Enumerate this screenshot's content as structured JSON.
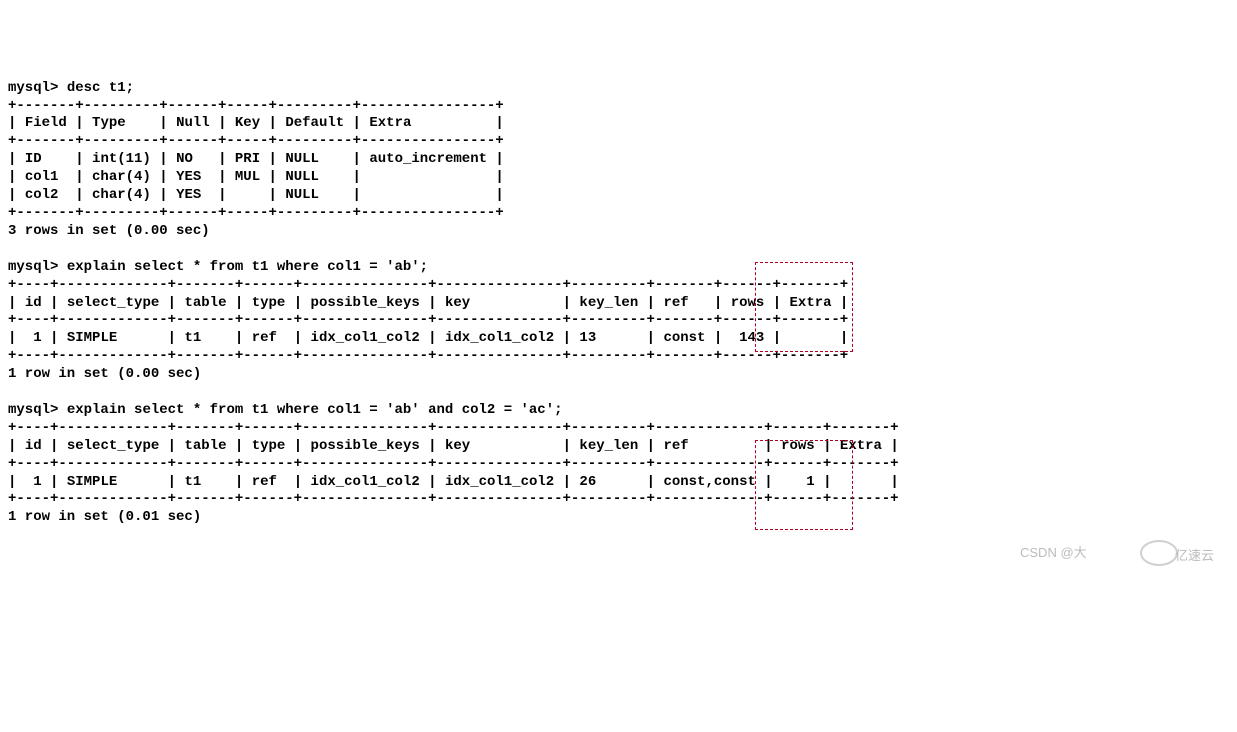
{
  "prompt": "mysql>",
  "cmd1": "desc t1;",
  "desc": {
    "headers": [
      "Field",
      "Type",
      "Null",
      "Key",
      "Default",
      "Extra"
    ],
    "rows": [
      [
        "ID",
        "int(11)",
        "NO",
        "PRI",
        "NULL",
        "auto_increment"
      ],
      [
        "col1",
        "char(4)",
        "YES",
        "MUL",
        "NULL",
        ""
      ],
      [
        "col2",
        "char(4)",
        "YES",
        "",
        "NULL",
        ""
      ]
    ],
    "footer": "3 rows in set (0.00 sec)"
  },
  "cmd2": "explain select * from t1 where col1 = 'ab';",
  "explain1": {
    "headers": [
      "id",
      "select_type",
      "table",
      "type",
      "possible_keys",
      "key",
      "key_len",
      "ref",
      "rows",
      "Extra"
    ],
    "rows": [
      [
        "1",
        "SIMPLE",
        "t1",
        "ref",
        "idx_col1_col2",
        "idx_col1_col2",
        "13",
        "const",
        "143",
        ""
      ]
    ],
    "footer": "1 row in set (0.00 sec)"
  },
  "cmd3": "explain select * from t1 where col1 = 'ab' and col2 = 'ac';",
  "explain2": {
    "headers": [
      "id",
      "select_type",
      "table",
      "type",
      "possible_keys",
      "key",
      "key_len",
      "ref",
      "rows",
      "Extra"
    ],
    "rows": [
      [
        "1",
        "SIMPLE",
        "t1",
        "ref",
        "idx_col1_col2",
        "idx_col1_col2",
        "26",
        "const,const",
        "1",
        ""
      ]
    ],
    "footer": "1 row in set (0.01 sec)"
  },
  "watermark_text": "CSDN @大",
  "watermark_brand": "亿速云"
}
